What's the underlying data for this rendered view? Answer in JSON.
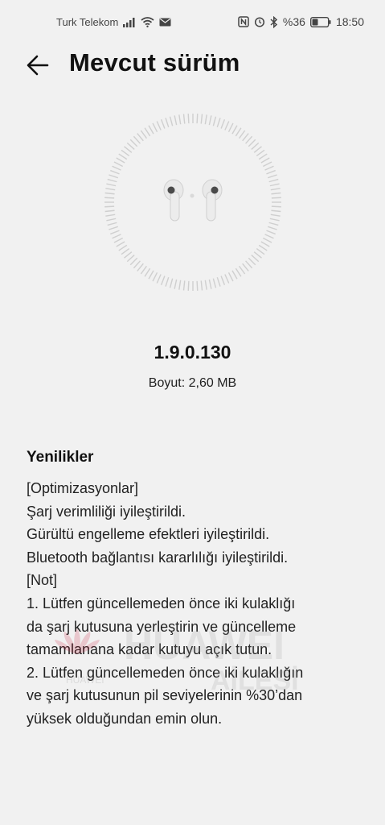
{
  "status_bar": {
    "carrier": "Turk Telekom",
    "battery_percent": "%36",
    "time": "18:50",
    "icons": [
      "signal-icon",
      "wifi-icon",
      "mail-icon",
      "nfc-icon",
      "alarm-icon",
      "bluetooth-icon",
      "battery-icon"
    ]
  },
  "header": {
    "back_icon": "arrow-left-icon",
    "title": "Mevcut sürüm"
  },
  "device": {
    "icon": "earbuds-icon",
    "version": "1.9.0.130",
    "size_label": "Boyut: 2,60 MB"
  },
  "whats_new": {
    "title": "Yenilikler",
    "lines": [
      "[Optimizasyonlar]",
      "Şarj verimliliği iyileştirildi.",
      "Gürültü engelleme efektleri iyileştirildi.",
      "Bluetooth bağlantısı kararlılığı iyileştirildi.",
      "[Not]",
      "1. Lütfen güncellemeden önce iki kulaklığı",
      "da şarj kutusuna yerleştirin ve güncelleme",
      "tamamlanana kadar kutuyu açık tutun.",
      "2. Lütfen güncellemeden önce iki kulaklığın",
      "ve şarj kutusunun pil seviyelerinin %30’dan",
      "yüksek olduğundan emin olun."
    ]
  },
  "watermark": {
    "brand": "HUAWEI",
    "text": "HUAWEI",
    "subtext": "AİLESİ"
  },
  "colors": {
    "background": "#f1f1f1",
    "text": "#1a1a1a",
    "ring_tick": "#cfcfcf",
    "watermark": "#c8102e"
  }
}
